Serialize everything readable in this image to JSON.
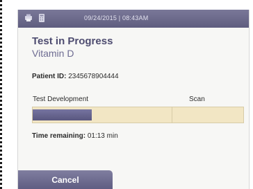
{
  "topbar": {
    "datetime": "09/24/2015 | 08:43AM",
    "icons": [
      "printer-icon",
      "calculator-icon"
    ]
  },
  "header": {
    "title": "Test in Progress",
    "subtitle": "Vitamin D"
  },
  "patient": {
    "label": "Patient ID:",
    "value": "2345678904444"
  },
  "progress": {
    "stages": [
      "Test Development",
      "Scan"
    ],
    "percent": 28
  },
  "time": {
    "label": "Time remaining:",
    "value": "01:13 min"
  },
  "buttons": {
    "cancel": "Cancel"
  },
  "colors": {
    "accent": "#5f5d7f",
    "bar_bg": "#f2e6c4",
    "bar_fill": "#6c6a95"
  }
}
